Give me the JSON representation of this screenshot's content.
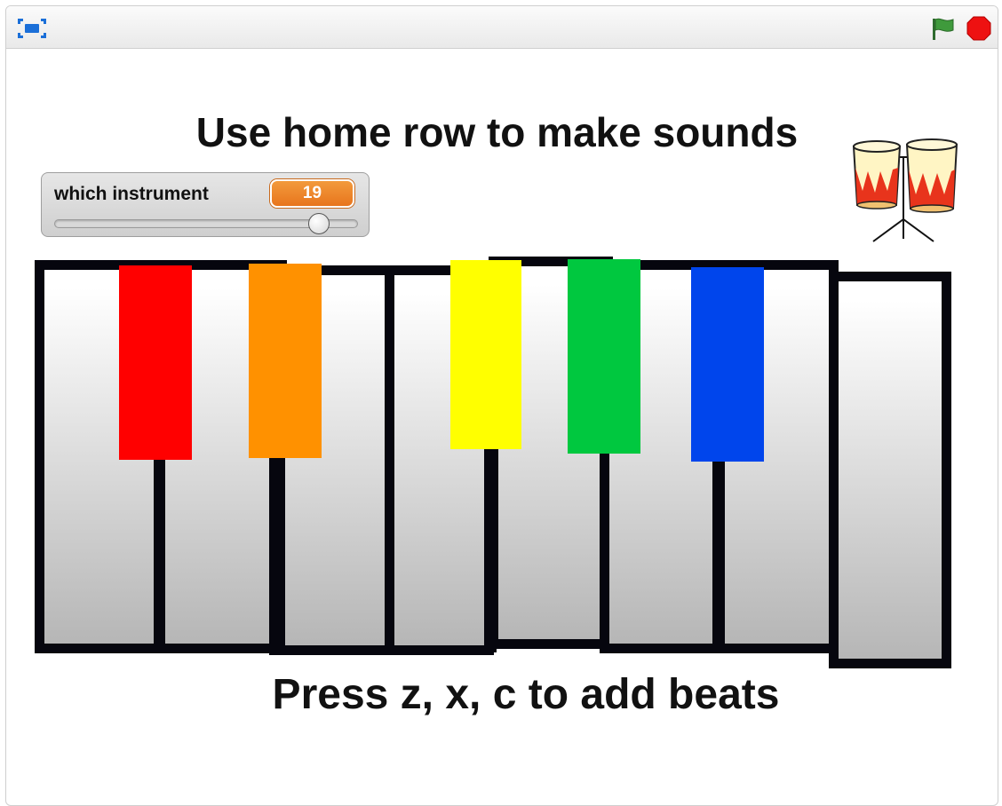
{
  "toolbar": {
    "fullscreen_icon": "fullscreen-toggle-icon",
    "green_flag_icon": "green-flag-icon",
    "stop_icon": "stop-sign-icon"
  },
  "stage": {
    "heading": "Use home row to make sounds",
    "footer": "Press z, x, c to add beats",
    "drum_sprite": "bongo-drums"
  },
  "slider": {
    "label": "which instrument",
    "value": "19",
    "level_fraction": 0.87
  },
  "piano": {
    "color_keys": [
      "#ff0000",
      "#ff9100",
      "#ffff00",
      "#00c83f",
      "#0045ec"
    ]
  }
}
